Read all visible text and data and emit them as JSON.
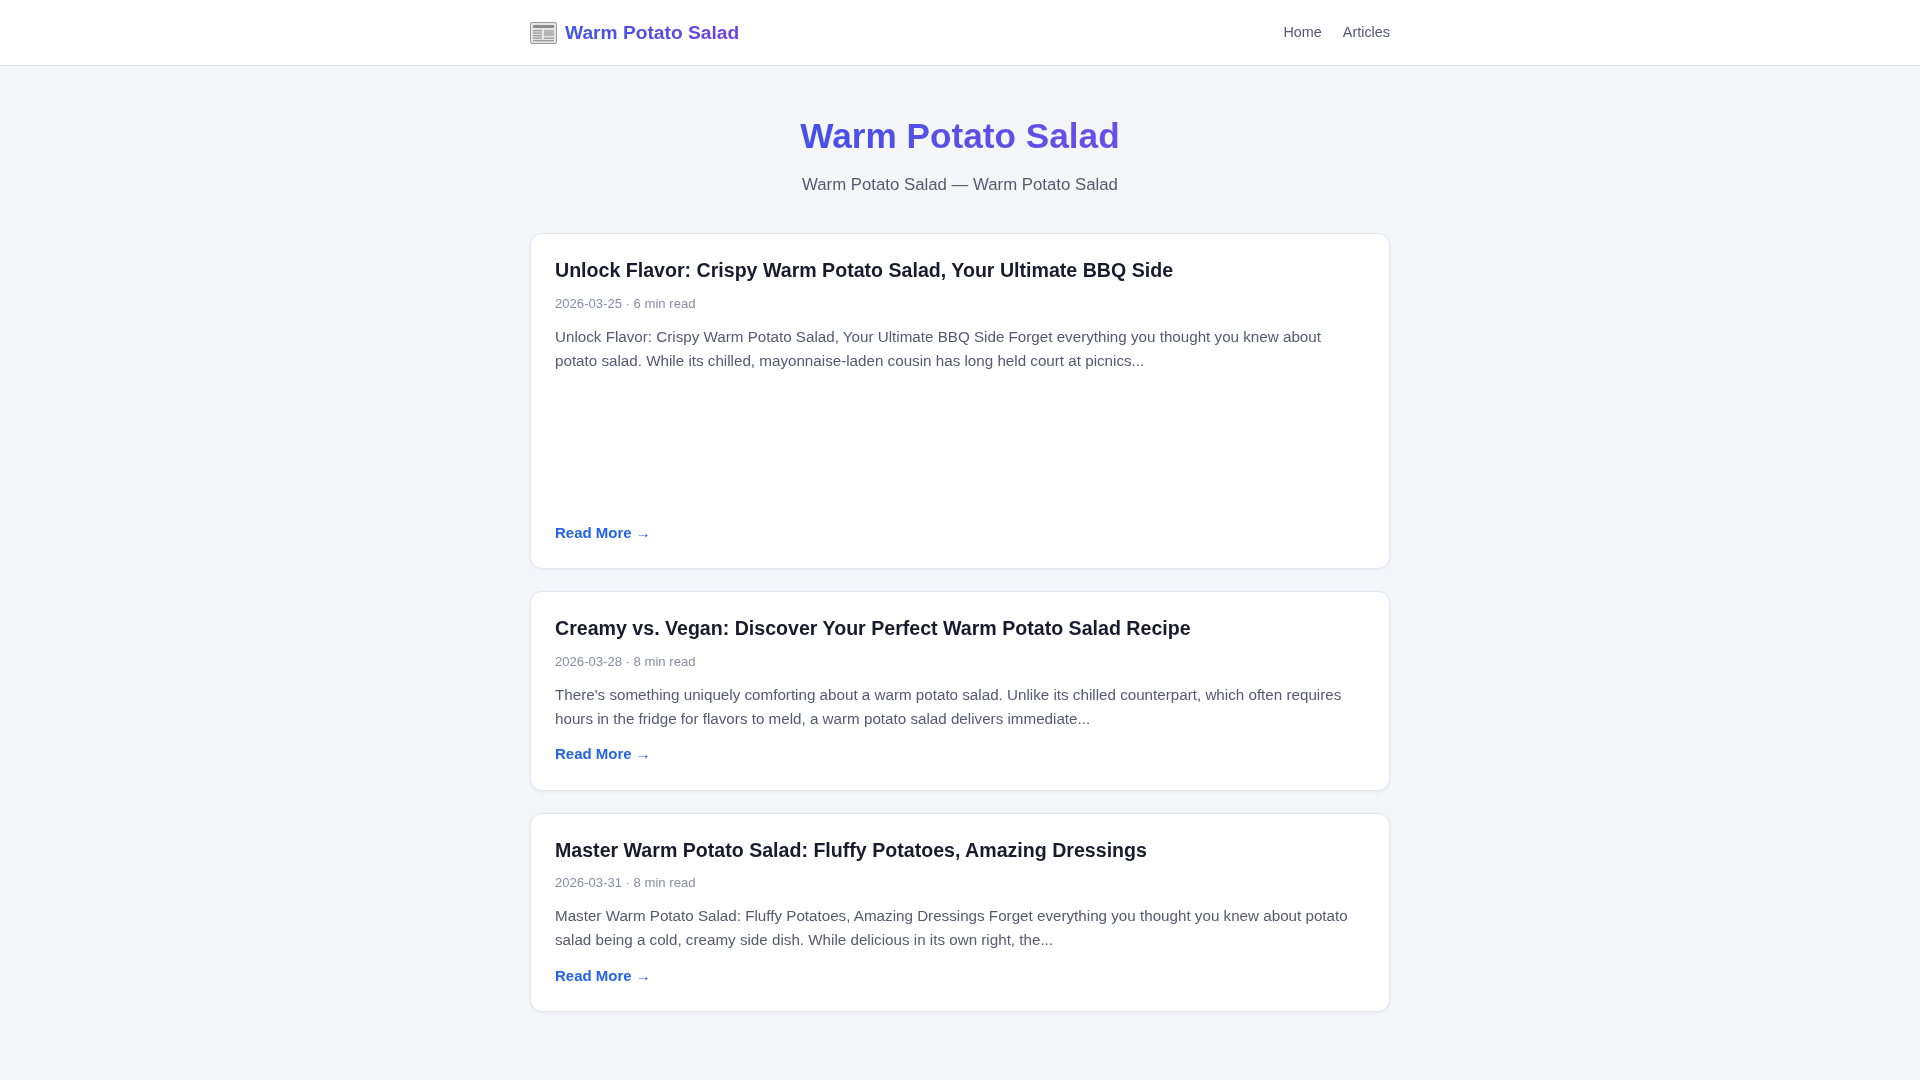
{
  "header": {
    "brand": "Warm Potato Salad",
    "nav": [
      {
        "label": "Home"
      },
      {
        "label": "Articles"
      }
    ]
  },
  "hero": {
    "title": "Warm Potato Salad",
    "subtitle": "Warm Potato Salad — Warm Potato Salad"
  },
  "articles": [
    {
      "title": "Unlock Flavor: Crispy Warm Potato Salad, Your Ultimate BBQ Side",
      "meta": "2026-03-25 · 6 min read",
      "excerpt": "Unlock Flavor: Crispy Warm Potato Salad, Your Ultimate BBQ Side Forget everything you thought you knew about potato salad. While its chilled, mayonnaise-laden cousin has long held court at picnics...",
      "link": "Read More →"
    },
    {
      "title": "Creamy vs. Vegan: Discover Your Perfect Warm Potato Salad Recipe",
      "meta": "2026-03-28 · 8 min read",
      "excerpt": "There's something uniquely comforting about a warm potato salad. Unlike its chilled counterpart, which often requires hours in the fridge for flavors to meld, a warm potato salad delivers immediate...",
      "link": "Read More →"
    },
    {
      "title": "Master Warm Potato Salad: Fluffy Potatoes, Amazing Dressings",
      "meta": "2026-03-31 · 8 min read",
      "excerpt": "Master Warm Potato Salad: Fluffy Potatoes, Amazing Dressings Forget everything you thought you knew about potato salad being a cold, creamy side dish. While delicious in its own right, the...",
      "link": "Read More →"
    }
  ]
}
